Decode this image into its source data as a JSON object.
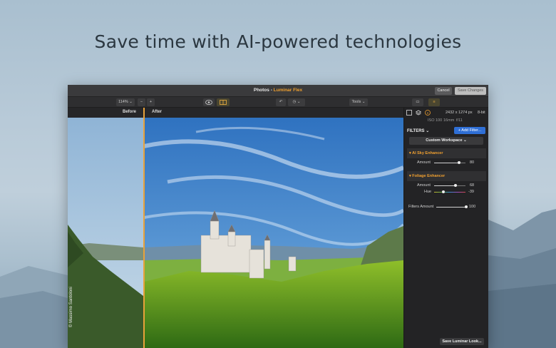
{
  "headline": "Save time with AI-powered technologies",
  "window": {
    "title_prefix": "Photos - ",
    "title_app": "Luminar Flex",
    "cancel_label": "Cancel",
    "save_changes_label": "Save Changes"
  },
  "toolbar": {
    "zoom": "114%",
    "zoom_out": "−",
    "zoom_in": "+",
    "tools_label": "Tools"
  },
  "view": {
    "before_label": "Before",
    "after_label": "After",
    "credit": "© Massimo Santoloni"
  },
  "panel": {
    "image_size": "2432 x 1274 px",
    "bit_depth": "8-bit",
    "iso": "ISO 100",
    "focal": "16mm",
    "aperture": "f/11",
    "filters_label": "FILTERS",
    "add_filter_label": "+ Add Filter...",
    "workspace_label": "Custom Workspace",
    "sky": {
      "title": "AI Sky Enhancer",
      "amount_label": "Amount",
      "amount_value": "80",
      "amount": 0.8
    },
    "foliage": {
      "title": "Foliage Enhancer",
      "amount_label": "Amount",
      "amount_value": "68",
      "amount": 0.68,
      "hue_label": "Hue",
      "hue_value": "-39",
      "hue": -0.39
    },
    "filters_amount_label": "Filters Amount",
    "filters_amount_value": "100",
    "filters_amount": 1.0,
    "save_look_label": "Save Luminar Look..."
  },
  "colors": {
    "accent": "#f0a030",
    "blue": "#2f6fd6"
  }
}
